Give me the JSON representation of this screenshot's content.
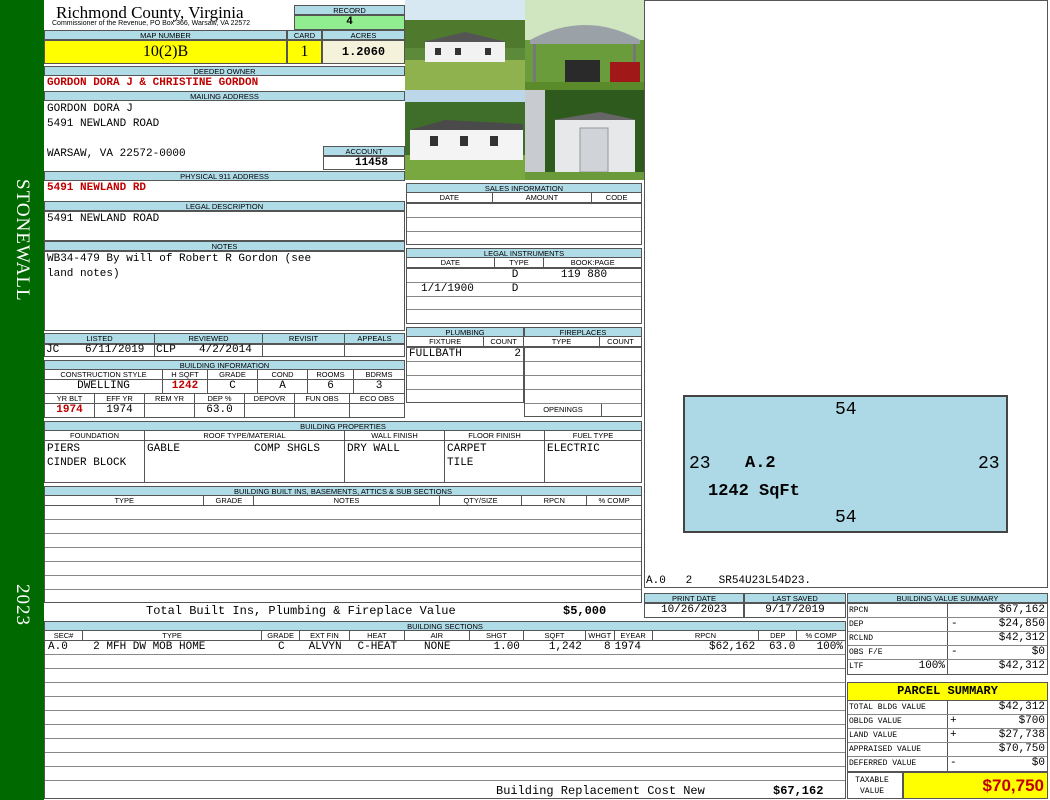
{
  "header": {
    "county": "Richmond County, Virginia",
    "commissioner": "Commissioner of the Revenue, PO Box 366, Warsaw, VA 22572",
    "record_label": "RECORD",
    "record": "4",
    "map_label": "MAP NUMBER",
    "map": "10(2)B",
    "card_label": "CARD",
    "card": "1",
    "acres_label": "ACRES",
    "acres": "1.2060"
  },
  "owner": {
    "label": "DEEDED OWNER",
    "value": "GORDON DORA J & CHRISTINE GORDON"
  },
  "mailing": {
    "label": "MAILING ADDRESS",
    "line1": "GORDON DORA J",
    "line2": "5491 NEWLAND ROAD",
    "line3": "WARSAW, VA 22572-0000"
  },
  "account": {
    "label": "ACCOUNT",
    "value": "11458"
  },
  "physical": {
    "label": "PHYSICAL 911 ADDRESS",
    "value": "5491 NEWLAND RD"
  },
  "legal": {
    "label": "LEGAL DESCRIPTION",
    "value": "5491 NEWLAND ROAD"
  },
  "notes": {
    "label": "NOTES",
    "line1": "WB34-479 By will of Robert R Gordon (see",
    "line2": "land notes)"
  },
  "side": {
    "district": "STONEWALL",
    "year": "2023"
  },
  "sales": {
    "label": "SALES INFORMATION",
    "cols": [
      "DATE",
      "AMOUNT",
      "CODE"
    ]
  },
  "instruments": {
    "label": "LEGAL INSTRUMENTS",
    "cols": [
      "DATE",
      "TYPE",
      "BOOK:PAGE"
    ],
    "rows": [
      {
        "date": "",
        "type": "D",
        "book": "119 880"
      },
      {
        "date": "1/1/1900",
        "type": "D",
        "book": ""
      }
    ]
  },
  "review": {
    "cols": [
      "LISTED",
      "REVIEWED",
      "REVISIT",
      "APPEALS"
    ],
    "listed_by": "JC",
    "listed": "6/11/2019",
    "reviewed_by": "CLP",
    "reviewed": "4/2/2014"
  },
  "building": {
    "label": "BUILDING INFORMATION",
    "cols1": [
      "CONSTRUCTION STYLE",
      "H SQFT",
      "GRADE",
      "COND",
      "ROOMS",
      "BDRMS"
    ],
    "style": "DWELLING",
    "hsqft": "1242",
    "grade": "C",
    "cond": "A",
    "rooms": "6",
    "bdrms": "3",
    "cols2": [
      "YR BLT",
      "EFF YR",
      "REM YR",
      "DEP %",
      "DEPOVR",
      "FUN OBS",
      "ECO OBS"
    ],
    "yrblt": "1974",
    "effyr": "1974",
    "dep": "63.0"
  },
  "plumbing": {
    "label": "PLUMBING",
    "cols": [
      "FIXTURE",
      "COUNT"
    ],
    "fixture": "FULLBATH",
    "count": "2"
  },
  "fireplaces": {
    "label": "FIREPLACES",
    "cols": [
      "TYPE",
      "COUNT"
    ],
    "openings": "OPENINGS"
  },
  "props": {
    "label": "BUILDING PROPERTIES",
    "cols": [
      "FOUNDATION",
      "ROOF TYPE/MATERIAL",
      "WALL FINISH",
      "FLOOR FINISH",
      "FUEL TYPE"
    ],
    "found1": "PIERS",
    "found2": "CINDER BLOCK",
    "roof1": "GABLE",
    "roof2": "COMP SHGLS",
    "wall": "DRY WALL",
    "floor1": "CARPET",
    "floor2": "TILE",
    "fuel": "ELECTRIC"
  },
  "builtins": {
    "label": "BUILDING BUILT INS, BASEMENTS, ATTICS & SUB SECTIONS",
    "cols": [
      "TYPE",
      "GRADE",
      "NOTES",
      "QTY/SIZE",
      "RPCN",
      "% COMP"
    ],
    "total_label": "Total Built Ins, Plumbing & Fireplace Value",
    "total": "$5,000"
  },
  "sections": {
    "label": "BUILDING SECTIONS",
    "cols": [
      "SEC#",
      "TYPE",
      "GRADE",
      "EXT FIN",
      "HEAT",
      "AIR",
      "SHGT",
      "SQFT",
      "WHGT",
      "EYEAR",
      "RPCN",
      "DEP",
      "% COMP"
    ],
    "row": [
      "A.0",
      "2 MFH DW MOB HOME",
      "C",
      "ALVYN",
      "C-HEAT",
      "NONE",
      "1.00",
      "1,242",
      "8",
      "1974",
      "$62,162",
      "63.0",
      "100%"
    ],
    "rcn_label": "Building Replacement Cost New",
    "rcn": "$67,162"
  },
  "sketch": {
    "top": "54",
    "bottom": "54",
    "left": "23",
    "right": "23",
    "label": "A.2",
    "area": "1242 SqFt",
    "code": "A.0   2    SR54U23L54D23."
  },
  "dates": {
    "print_label": "PRINT DATE",
    "print": "10/26/2023",
    "saved_label": "LAST SAVED",
    "saved": "9/17/2019"
  },
  "bvs": {
    "label": "BUILDING VALUE SUMMARY",
    "rows": [
      {
        "k": "RPCN",
        "s": "",
        "v": "$67,162"
      },
      {
        "k": "DEP",
        "s": "-",
        "v": "$24,850"
      },
      {
        "k": "RCLND",
        "s": "",
        "v": "$42,312"
      },
      {
        "k": "OBS F/E",
        "s": "-",
        "v": "$0"
      },
      {
        "k": "LTF",
        "s": "100%",
        "v": "$42,312"
      }
    ]
  },
  "parcel": {
    "label": "PARCEL SUMMARY",
    "rows": [
      {
        "k": "TOTAL BLDG VALUE",
        "s": "",
        "v": "$42,312"
      },
      {
        "k": "OBLDG VALUE",
        "s": "+",
        "v": "$700"
      },
      {
        "k": "LAND VALUE",
        "s": "+",
        "v": "$27,738"
      },
      {
        "k": "APPRAISED VALUE",
        "s": "",
        "v": "$70,750"
      },
      {
        "k": "DEFERRED VALUE",
        "s": "-",
        "v": "$0"
      }
    ],
    "taxable_label": "TAXABLE VALUE",
    "taxable": "$70,750"
  },
  "colors": {
    "header": "#b0dce8",
    "side": "#006a00",
    "yellow": "#ffff00",
    "green": "#90ee90",
    "red": "#c00000"
  }
}
